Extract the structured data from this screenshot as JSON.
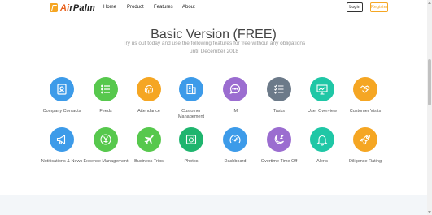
{
  "header": {
    "logo_text_accent": "Ai",
    "logo_text_rest": "rPalm",
    "nav": [
      "Home",
      "Product",
      "Features",
      "About"
    ],
    "login_label": "Login",
    "register_label": "Register"
  },
  "hero": {
    "title": "Basic Version (FREE)",
    "subtitle": "Try us out today and use the following features for free without any obligations until December 2018"
  },
  "features": [
    {
      "label": "Company Contacts",
      "icon": "contacts-icon",
      "color": "#3d9be9"
    },
    {
      "label": "Feeds",
      "icon": "feeds-icon",
      "color": "#57c84d"
    },
    {
      "label": "Attendance",
      "icon": "fingerprint-icon",
      "color": "#f5a623"
    },
    {
      "label": "Customer Management",
      "icon": "building-icon",
      "color": "#3d9be9"
    },
    {
      "label": "IM",
      "icon": "chat-icon",
      "color": "#9b6dd0"
    },
    {
      "label": "Tasks",
      "icon": "tasks-icon",
      "color": "#6c7a89"
    },
    {
      "label": "User Overview",
      "icon": "presentation-icon",
      "color": "#1fc7a6"
    },
    {
      "label": "Customer Visits",
      "icon": "handshake-icon",
      "color": "#f5a623"
    },
    {
      "label": "Notifications & News",
      "icon": "megaphone-icon",
      "color": "#3d9be9"
    },
    {
      "label": "Expense Management",
      "icon": "yen-icon",
      "color": "#57c84d"
    },
    {
      "label": "Business Trips",
      "icon": "airplane-icon",
      "color": "#57c84d"
    },
    {
      "label": "Photos",
      "icon": "camera-icon",
      "color": "#1fb56e"
    },
    {
      "label": "Dashboard",
      "icon": "gauge-icon",
      "color": "#3d9be9"
    },
    {
      "label": "Overtime Time Off",
      "icon": "moon-icon",
      "color": "#9b6dd0"
    },
    {
      "label": "Alerts",
      "icon": "bell-icon",
      "color": "#1fc7a6"
    },
    {
      "label": "Diligence Rating",
      "icon": "rocket-icon",
      "color": "#f5a623"
    }
  ]
}
